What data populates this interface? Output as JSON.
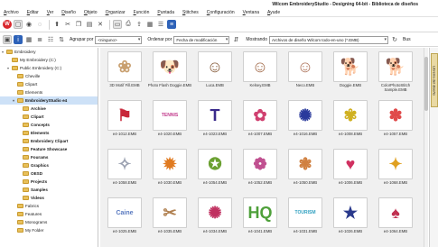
{
  "window": {
    "title": "Wilcom EmbroideryStudio - Designing 64-bit - Biblioteca de diseños"
  },
  "menu": [
    "Archivo",
    "Editar",
    "Ver",
    "Diseño",
    "Objeto",
    "Organizar",
    "Función",
    "Puntada",
    "Stitches",
    "Configuración",
    "Ventana",
    "Ayude"
  ],
  "toolbar2": {
    "groupby_label": "Agrupar por",
    "groupby_value": "<ninguno>",
    "sortby_label": "Ordenar por",
    "sortby_value": "Fecha de modificación",
    "show_label": "Mostrando",
    "show_value": "Archivos de diseño Wilcom todo-en-uno (*.EMB)",
    "search_label": "Bus"
  },
  "tree": [
    {
      "label": "Embroidery",
      "depth": 0,
      "bold": false,
      "exp": "▾"
    },
    {
      "label": "My Embroidery (C:)",
      "depth": 1,
      "bold": false,
      "exp": ""
    },
    {
      "label": "Public Embroidery (C:)",
      "depth": 1,
      "bold": false,
      "exp": "▾"
    },
    {
      "label": "Cheville",
      "depth": 2,
      "bold": false,
      "exp": ""
    },
    {
      "label": "Clipart",
      "depth": 2,
      "bold": false,
      "exp": ""
    },
    {
      "label": "Elements",
      "depth": 2,
      "bold": false,
      "exp": ""
    },
    {
      "label": "EmbroideryStudio e4",
      "depth": 2,
      "bold": true,
      "exp": "▾",
      "selected": true
    },
    {
      "label": "Archive",
      "depth": 3,
      "bold": true,
      "exp": ""
    },
    {
      "label": "Clipart",
      "depth": 3,
      "bold": true,
      "exp": ""
    },
    {
      "label": "Concepts",
      "depth": 3,
      "bold": true,
      "exp": ""
    },
    {
      "label": "Elements",
      "depth": 3,
      "bold": true,
      "exp": ""
    },
    {
      "label": "Embroidery Clipart",
      "depth": 3,
      "bold": true,
      "exp": ""
    },
    {
      "label": "Feature Showcase",
      "depth": 3,
      "bold": true,
      "exp": ""
    },
    {
      "label": "Fourams",
      "depth": 3,
      "bold": true,
      "exp": ""
    },
    {
      "label": "Graphics",
      "depth": 3,
      "bold": true,
      "exp": ""
    },
    {
      "label": "OESD",
      "depth": 3,
      "bold": true,
      "exp": ""
    },
    {
      "label": "Projects",
      "depth": 3,
      "bold": true,
      "exp": ""
    },
    {
      "label": "Samples",
      "depth": 3,
      "bold": true,
      "exp": ""
    },
    {
      "label": "Videos",
      "depth": 3,
      "bold": true,
      "exp": ""
    },
    {
      "label": "Fabrics",
      "depth": 2,
      "bold": false,
      "exp": ""
    },
    {
      "label": "Features",
      "depth": 2,
      "bold": false,
      "exp": ""
    },
    {
      "label": "Monograms",
      "depth": 2,
      "bold": false,
      "exp": ""
    },
    {
      "label": "My Folder",
      "depth": 2,
      "bold": false,
      "exp": ""
    }
  ],
  "tiles": [
    {
      "caption": "3D Motif Fill.EMB",
      "glyph": "❀",
      "color": "#c9a070"
    },
    {
      "caption": "Photo Flash Doggie.EMB",
      "glyph": "🐶",
      "color": "#7a5a40"
    },
    {
      "caption": "Luca.EMB",
      "glyph": "☺",
      "color": "#8a6040"
    },
    {
      "caption": "Kelsey.EMB",
      "glyph": "☺",
      "color": "#a57050"
    },
    {
      "caption": "Neco.EMB",
      "glyph": "☺",
      "color": "#b07860"
    },
    {
      "caption": "Doggie.EMB",
      "glyph": "🐕",
      "color": "#7a6050"
    },
    {
      "caption": "ColorPhotoStitch Sample.EMB",
      "glyph": "🐕",
      "color": "#8a5a3a"
    },
    {
      "caption": "e4-1012.EMB",
      "glyph": "⚑",
      "color": "#c8283a"
    },
    {
      "caption": "e4-1020.EMB",
      "glyph": "TENNIS",
      "color": "#c23a8c"
    },
    {
      "caption": "e4-1023.EMB",
      "glyph": "T",
      "color": "#3a2a8c"
    },
    {
      "caption": "e4-1007.EMB",
      "glyph": "✿",
      "color": "#d04070"
    },
    {
      "caption": "e4-1016.EMB",
      "glyph": "✺",
      "color": "#2a3a9c"
    },
    {
      "caption": "e4-1008.EMB",
      "glyph": "✾",
      "color": "#d0b020"
    },
    {
      "caption": "e4-1057.EMB",
      "glyph": "✽",
      "color": "#e04a4a"
    },
    {
      "caption": "e4-1058.EMB",
      "glyph": "✧",
      "color": "#9aa0b0"
    },
    {
      "caption": "e4-1030.EMB",
      "glyph": "✹",
      "color": "#e07a20"
    },
    {
      "caption": "e4-1054.EMB",
      "glyph": "✪",
      "color": "#6aa030"
    },
    {
      "caption": "e4-1052.EMB",
      "glyph": "❁",
      "color": "#c05090"
    },
    {
      "caption": "e4-1050.EMB",
      "glyph": "❃",
      "color": "#d08040"
    },
    {
      "caption": "e4-1006.EMB",
      "glyph": "♥",
      "color": "#d03060"
    },
    {
      "caption": "e4-1068.EMB",
      "glyph": "✦",
      "color": "#e0a020"
    },
    {
      "caption": "e4-1025.EMB",
      "glyph": "Caine",
      "color": "#5a7ac0"
    },
    {
      "caption": "e4-1035.EMB",
      "glyph": "✂",
      "color": "#b08050"
    },
    {
      "caption": "e4-1034.EMB",
      "glyph": "✺",
      "color": "#c03060"
    },
    {
      "caption": "e4-1041.EMB",
      "glyph": "HQ",
      "color": "#4ea03a"
    },
    {
      "caption": "e4-1031.EMB",
      "glyph": "TOURISM",
      "color": "#30a0c0"
    },
    {
      "caption": "e4-1026.EMB",
      "glyph": "★",
      "color": "#2a3a8c"
    },
    {
      "caption": "e4-1064.EMB",
      "glyph": "♠",
      "color": "#c03050"
    }
  ],
  "sidetab": {
    "label": "Librería del diseño"
  },
  "colors": {
    "accent": "#2e62b8",
    "selected_row": "#cde1f7",
    "folder": "#e8c05a",
    "background": "#f0f0f0"
  }
}
